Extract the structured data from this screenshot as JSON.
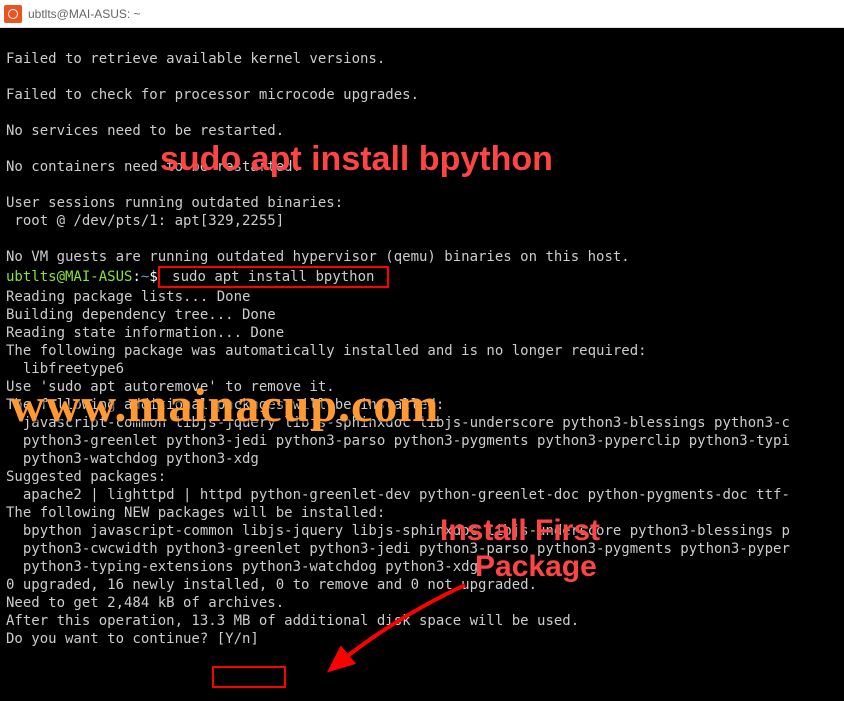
{
  "window": {
    "title": "ubtlts@MAI-ASUS: ~"
  },
  "lines": {
    "l1": "Failed to retrieve available kernel versions.",
    "l2": "",
    "l3": "Failed to check for processor microcode upgrades.",
    "l4": "",
    "l5": "No services need to be restarted.",
    "l6": "",
    "l7": "No containers need to be restarted.",
    "l8": "",
    "l9": "User sessions running outdated binaries:",
    "l10": " root @ /dev/pts/1: apt[329,2255]",
    "l11": "",
    "l12": "No VM guests are running outdated hypervisor (qemu) binaries on this host.",
    "l14": "Reading package lists... Done",
    "l15": "Building dependency tree... Done",
    "l16": "Reading state information... Done",
    "l17": "The following package was automatically installed and is no longer required:",
    "l18": "  libfreetype6",
    "l19": "Use 'sudo apt autoremove' to remove it.",
    "l20": "The following additional packages will be installed:",
    "l21": "  javascript-common libjs-jquery libjs-sphinxdoc libjs-underscore python3-blessings python3-c",
    "l22": "  python3-greenlet python3-jedi python3-parso python3-pygments python3-pyperclip python3-typi",
    "l23": "  python3-watchdog python3-xdg",
    "l24": "Suggested packages:",
    "l25": "  apache2 | lighttpd | httpd python-greenlet-dev python-greenlet-doc python-pygments-doc ttf-",
    "l26": "The following NEW packages will be installed:",
    "l27": "  bpython javascript-common libjs-jquery libjs-sphinxdoc libjs-underscore python3-blessings p",
    "l28": "  python3-cwcwidth python3-greenlet python3-jedi python3-parso python3-pygments python3-pyper",
    "l29": "  python3-typing-extensions python3-watchdog python3-xdg",
    "l30": "0 upgraded, 16 newly installed, 0 to remove and 0 not upgraded.",
    "l31": "Need to get 2,484 kB of archives.",
    "l32": "After this operation, 13.3 MB of additional disk space will be used.",
    "l33": "Do you want to continue? [Y/n]"
  },
  "prompt": {
    "user_host": "ubtlts@MAI-ASUS",
    "colon": ":",
    "path": "~",
    "dollar": "$",
    "command": " sudo apt install bpython "
  },
  "annotations": {
    "top_red": "sudo apt install bpython",
    "watermark": "www.mainacup.com",
    "install_first": "Install First",
    "package": "Package"
  }
}
